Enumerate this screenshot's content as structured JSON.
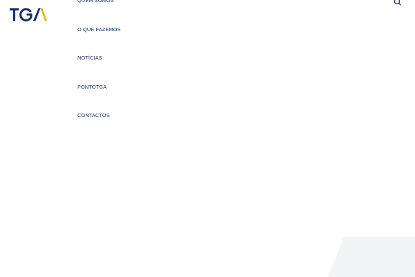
{
  "brand": {
    "logo_text": "TGA",
    "primary_color": "#1c2e6b",
    "accent_color": "#f2b01e"
  },
  "nav": {
    "items": [
      {
        "label": "QUEM SOMOS"
      },
      {
        "label": "O QUE FAZEMOS"
      },
      {
        "label": "NOTÍCIAS"
      },
      {
        "label": "PONTOTGA"
      },
      {
        "label": "CONTACTOS"
      }
    ]
  },
  "header": {
    "search_icon": "search-icon"
  }
}
